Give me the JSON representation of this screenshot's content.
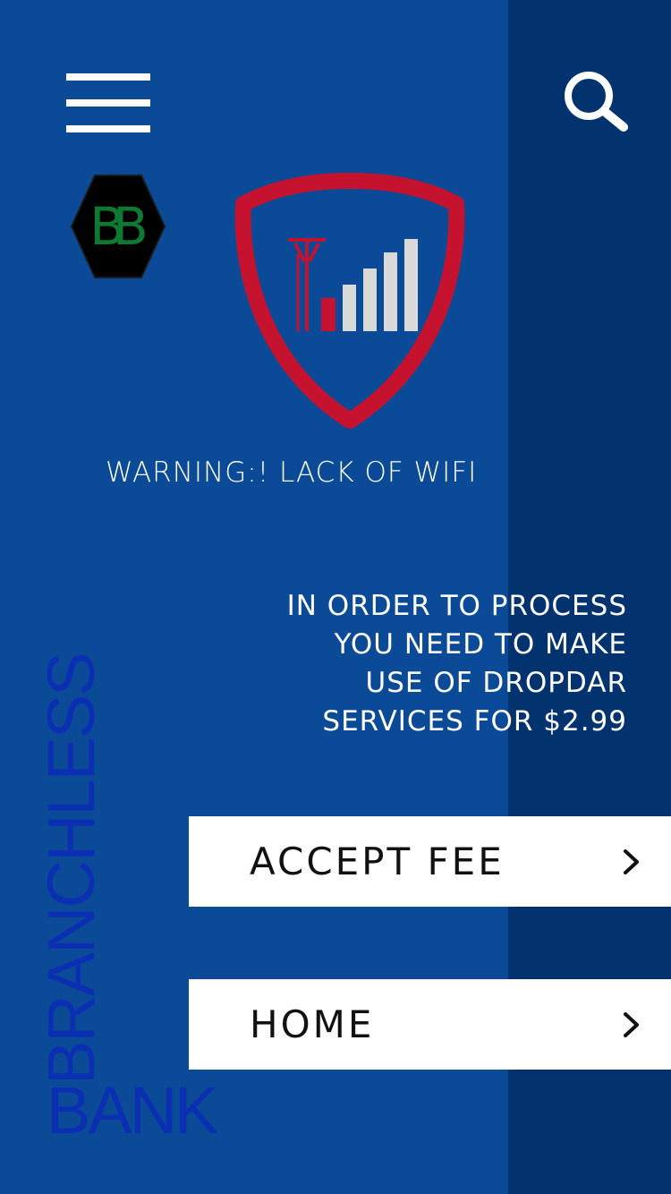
{
  "header": {
    "menu_icon": "hamburger-menu-icon",
    "search_icon": "search-icon"
  },
  "badge": {
    "text": "BB",
    "icon": "hexagon-logo-icon"
  },
  "alert": {
    "icon": "shield-signal-icon",
    "title": "WARNING:! LACK OF WIFI"
  },
  "message": {
    "lines": [
      "IN ORDER TO PROCESS",
      "YOU NEED TO MAKE",
      "USE OF DROPDAR",
      "SERVICES FOR $2.99"
    ]
  },
  "actions": {
    "accept_fee_label": "ACCEPT FEE",
    "home_label": "HOME",
    "chevron_icon": "chevron-right-icon"
  },
  "brand": {
    "vertical_text": "BRANCHLESS",
    "horizontal_text": "BANK"
  },
  "colors": {
    "background": "#0b4a96",
    "stripe": "#03336f",
    "shield_red": "#c4122f",
    "brand_blue": "#0a2fb3",
    "badge_green": "#0d7a34"
  }
}
